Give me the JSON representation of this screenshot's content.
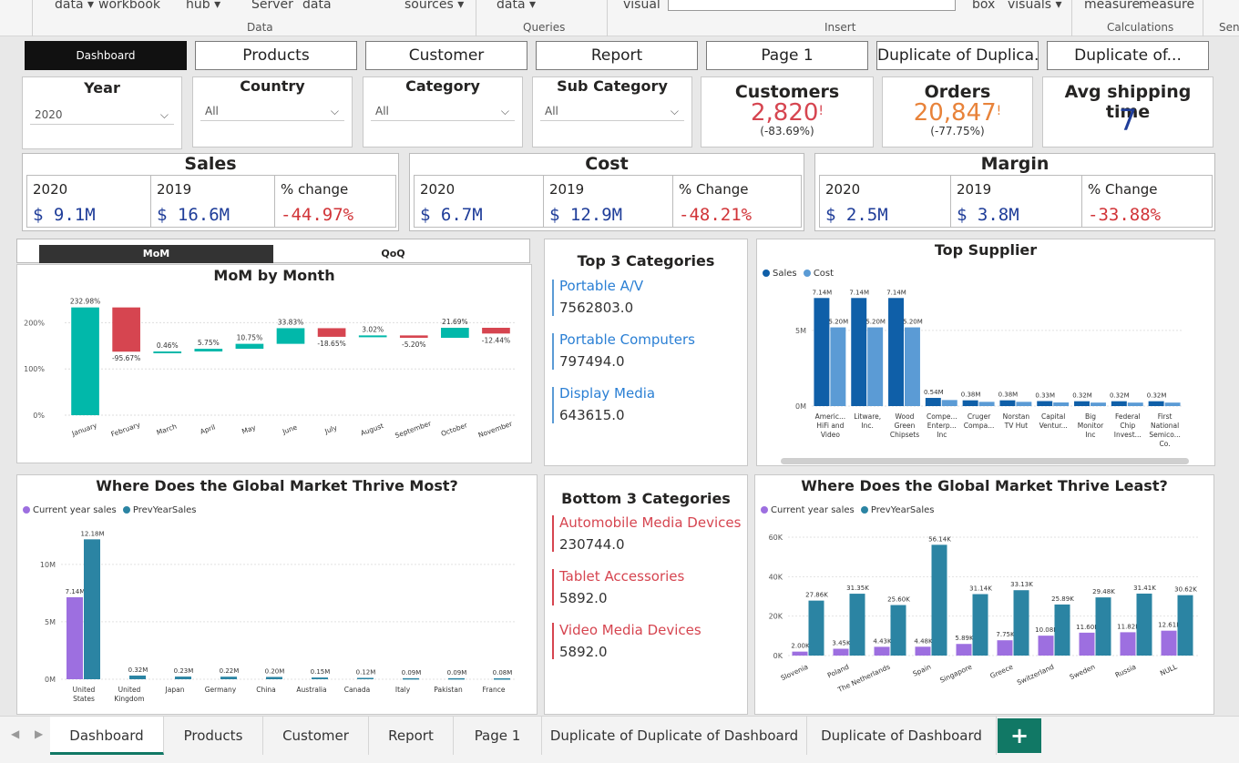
{
  "ribbon": {
    "items": [
      "data ▾",
      "workbook",
      "hub ▾",
      "Server",
      "data",
      "sources ▾",
      "data ▾",
      "visual",
      "box",
      "visuals ▾",
      "measure",
      "measure"
    ],
    "groups": [
      "Data",
      "Queries",
      "Insert",
      "Calculations",
      "Sens"
    ]
  },
  "nav": [
    {
      "label": "Dashboard",
      "active": true
    },
    {
      "label": "Products"
    },
    {
      "label": "Customer"
    },
    {
      "label": "Report"
    },
    {
      "label": "Page 1"
    },
    {
      "label": "Duplicate of Duplica..."
    },
    {
      "label": "Duplicate of..."
    }
  ],
  "slicers": {
    "year": {
      "title": "Year",
      "value": "2020"
    },
    "country": {
      "title": "Country",
      "value": "All"
    },
    "category": {
      "title": "Category",
      "value": "All"
    },
    "subcategory": {
      "title": "Sub Category",
      "value": "All"
    }
  },
  "kpis": {
    "customers": {
      "title": "Customers",
      "value": "2,820",
      "flag": "!",
      "change": "(-83.69%)"
    },
    "orders": {
      "title": "Orders",
      "value": "20,847",
      "flag": "!",
      "change": "(-77.75%)"
    },
    "shipping": {
      "title": "Avg shipping time",
      "value": "7"
    }
  },
  "sales": {
    "title": "Sales",
    "h1": "2020",
    "h2": "2019",
    "h3": "% change",
    "v1": "$ 9.1M",
    "v2": "$ 16.6M",
    "v3": "-44.97%"
  },
  "cost": {
    "title": "Cost",
    "h1": "2020",
    "h2": "2019",
    "h3": "% Change",
    "v1": "$ 6.7M",
    "v2": "$ 12.9M",
    "v3": "-48.21%"
  },
  "margin": {
    "title": "Margin",
    "h1": "2020",
    "h2": "2019",
    "h3": "% Change",
    "v1": "$ 2.5M",
    "v2": "$ 3.8M",
    "v3": "-33.88%"
  },
  "toggle": {
    "mom": "MoM",
    "qoq": "QoQ"
  },
  "top3": {
    "title": "Top 3 Categories",
    "items": [
      {
        "name": "Portable A/V",
        "value": "7562803.0"
      },
      {
        "name": "Portable Computers",
        "value": "797494.0"
      },
      {
        "name": "Display Media",
        "value": "643615.0"
      }
    ]
  },
  "bottom3": {
    "title": "Bottom 3 Categories",
    "items": [
      {
        "name": "Automobile Media Devices",
        "value": "230744.0"
      },
      {
        "name": "Tablet Accessories",
        "value": "5892.0"
      },
      {
        "name": "Video Media Devices",
        "value": "5892.0"
      }
    ]
  },
  "charts": {
    "mom_title": "MoM by Month",
    "supplier_title": "Top Supplier",
    "most_title": "Where Does the Global Market Thrive Most?",
    "least_title": "Where Does the Global Market Thrive Least?",
    "legend_sales": "Sales",
    "legend_cost": "Cost",
    "legend_cur": "Current year sales",
    "legend_prev": "PrevYearSales"
  },
  "colors": {
    "teal": "#01b8aa",
    "red": "#d64550",
    "darkblue": "#0f5fa8",
    "lightblue": "#5b9bd5",
    "purple": "#9d6fe0",
    "prev": "#2b84a3",
    "black": "#111111"
  },
  "chart_data": [
    {
      "type": "bar",
      "subtype": "waterfall",
      "title": "MoM by Month",
      "categories": [
        "January",
        "February",
        "March",
        "April",
        "May",
        "June",
        "July",
        "August",
        "September",
        "October",
        "November"
      ],
      "values": [
        232.98,
        -95.67,
        0.46,
        5.75,
        10.75,
        33.83,
        -18.65,
        3.02,
        -5.2,
        21.69,
        -12.44
      ],
      "labels": [
        "232.98%",
        "-95.67%",
        "0.46%",
        "5.75%",
        "10.75%",
        "33.83%",
        "-18.65%",
        "3.02%",
        "-5.20%",
        "21.69%",
        "-12.44%"
      ],
      "yticks": [
        "0%",
        "100%",
        "200%"
      ],
      "ylim": [
        0,
        250
      ]
    },
    {
      "type": "bar",
      "title": "Top Supplier",
      "categories": [
        "Americ... HiFi and Video",
        "Litware, Inc.",
        "Wood Green Chipsets",
        "Compe... Enterp... Inc",
        "Cruger Compa...",
        "Norstan TV Hut",
        "Capital Ventur...",
        "Big Monitor Inc",
        "Federal Chip Invest...",
        "First National Semico... Co."
      ],
      "series": [
        {
          "name": "Sales",
          "values": [
            7.14,
            7.14,
            7.14,
            0.54,
            0.38,
            0.38,
            0.33,
            0.32,
            0.32,
            0.32
          ],
          "labels": [
            "7.14M",
            "7.14M",
            "7.14M",
            "0.54M",
            "0.38M",
            "0.38M",
            "0.33M",
            "0.32M",
            "0.32M",
            "0.32M"
          ]
        },
        {
          "name": "Cost",
          "values": [
            5.2,
            5.2,
            5.2,
            0.4,
            0.28,
            0.28,
            0.24,
            0.23,
            0.23,
            0.23
          ],
          "labels": [
            "5.20M",
            "5.20M",
            "5.20M",
            "",
            "",
            "",
            "",
            "",
            "",
            ""
          ]
        }
      ],
      "yticks": [
        "0M",
        "5M"
      ],
      "ylim": [
        0,
        8
      ]
    },
    {
      "type": "bar",
      "title": "Where Does the Global Market Thrive Most?",
      "categories": [
        "United States",
        "United Kingdom",
        "Japan",
        "Germany",
        "China",
        "Australia",
        "Canada",
        "Italy",
        "Pakistan",
        "France"
      ],
      "series": [
        {
          "name": "Current year sales",
          "values": [
            7.14,
            0.0,
            0.0,
            0.0,
            0.0,
            0.0,
            0.0,
            0.0,
            0.0,
            0.0
          ],
          "labels": [
            "7.14M",
            "",
            "",
            "",
            "",
            "",
            "",
            "",
            "",
            ""
          ]
        },
        {
          "name": "PrevYearSales",
          "values": [
            12.18,
            0.32,
            0.23,
            0.22,
            0.2,
            0.15,
            0.12,
            0.09,
            0.09,
            0.08
          ],
          "labels": [
            "12.18M",
            "0.32M",
            "0.23M",
            "0.22M",
            "0.20M",
            "0.15M",
            "0.12M",
            "0.09M",
            "0.09M",
            "0.08M"
          ]
        }
      ],
      "yticks": [
        "0M",
        "5M",
        "10M"
      ],
      "ylim": [
        0,
        13
      ]
    },
    {
      "type": "bar",
      "title": "Where Does the Global Market Thrive Least?",
      "categories": [
        "Slovenia",
        "Poland",
        "The Netherlands",
        "Spain",
        "Singapore",
        "Greece",
        "Switzerland",
        "Sweden",
        "Russia",
        "NULL"
      ],
      "series": [
        {
          "name": "Current year sales",
          "values": [
            2.0,
            3.45,
            4.43,
            4.48,
            5.89,
            7.75,
            10.08,
            11.6,
            11.82,
            12.61
          ],
          "labels": [
            "2.00K",
            "3.45K",
            "4.43K",
            "4.48K",
            "5.89K",
            "7.75K",
            "10.08K",
            "11.60K",
            "11.82K",
            "12.61K"
          ]
        },
        {
          "name": "PrevYearSales",
          "values": [
            27.86,
            31.35,
            25.6,
            56.14,
            31.14,
            33.13,
            25.89,
            29.48,
            31.41,
            30.62
          ],
          "labels": [
            "27.86K",
            "31.35K",
            "25.60K",
            "56.14K",
            "31.14K",
            "33.13K",
            "25.89K",
            "29.48K",
            "31.41K",
            "30.62K"
          ]
        }
      ],
      "yticks": [
        "0K",
        "20K",
        "40K",
        "60K"
      ],
      "ylim": [
        0,
        60
      ]
    }
  ],
  "tabs": [
    {
      "label": "Dashboard",
      "active": true
    },
    {
      "label": "Products"
    },
    {
      "label": "Customer"
    },
    {
      "label": "Report"
    },
    {
      "label": "Page 1"
    },
    {
      "label": "Duplicate of Duplicate of Dashboard"
    },
    {
      "label": "Duplicate of Dashboard"
    }
  ],
  "add_tab": "+"
}
